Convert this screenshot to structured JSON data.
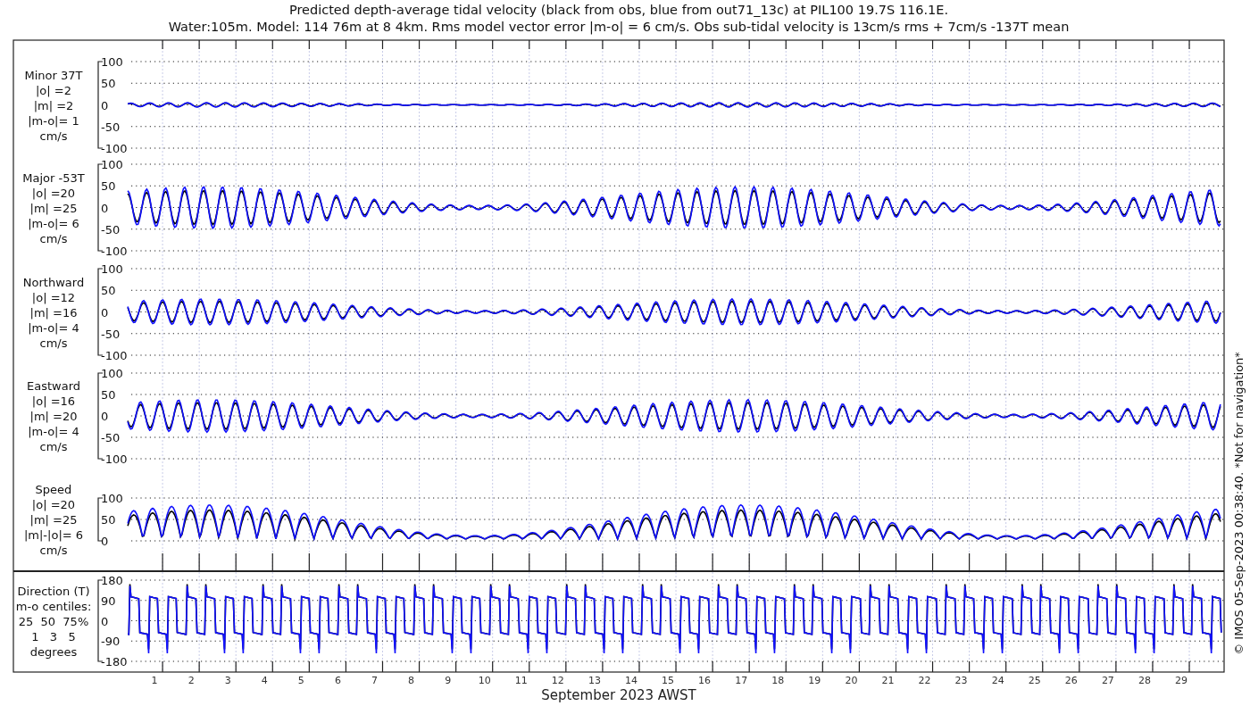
{
  "title_lines": [
    "Predicted depth-average tidal velocity (black from obs, blue from out71_13c) at PIL100 19.7S 116.1E.",
    "Water:105m. Model: 114 76m at 8 4km. Rms model vector error |m-o| = 6 cm/s. Obs sub-tidal velocity is 13cm/s rms + 7cm/s -137T mean"
  ],
  "panels": [
    {
      "kind": "signed",
      "label_lines": [
        "Minor 37T",
        "|o| =2",
        "|m| =2",
        "|m-o|= 1",
        "cm/s"
      ],
      "yticks": [
        "100",
        "50",
        "0",
        "-50",
        "-100"
      ]
    },
    {
      "kind": "signed",
      "label_lines": [
        "Major -53T",
        "|o| =20",
        "|m| =25",
        "|m-o|= 6",
        "cm/s"
      ],
      "yticks": [
        "100",
        "50",
        "0",
        "-50",
        "-100"
      ]
    },
    {
      "kind": "signed",
      "label_lines": [
        "Northward",
        "|o| =12",
        "|m| =16",
        "|m-o|= 4",
        "cm/s"
      ],
      "yticks": [
        "100",
        "50",
        "0",
        "-50",
        "-100"
      ]
    },
    {
      "kind": "signed",
      "label_lines": [
        "Eastward",
        "|o| =16",
        "|m| =20",
        "|m-o|= 4",
        "cm/s"
      ],
      "yticks": [
        "100",
        "50",
        "0",
        "-50",
        "-100"
      ]
    },
    {
      "kind": "speed",
      "label_lines": [
        "Speed",
        "|o| =20",
        "|m| =25",
        "|m|-|o|= 6",
        "cm/s"
      ],
      "yticks": [
        "100",
        "50",
        "0"
      ]
    }
  ],
  "direction_panel": {
    "label_lines": [
      "Direction (T)",
      "m-o centiles:",
      "25  50  75%",
      "1   3   5",
      "degrees"
    ],
    "yticks": [
      "180",
      "90",
      "0",
      "-90",
      "-180"
    ]
  },
  "x_tick_labels": [
    "1",
    "2",
    "3",
    "4",
    "5",
    "6",
    "7",
    "8",
    "9",
    "10",
    "11",
    "12",
    "13",
    "14",
    "15",
    "16",
    "17",
    "18",
    "19",
    "20",
    "21",
    "22",
    "23",
    "24",
    "25",
    "26",
    "27",
    "28",
    "29"
  ],
  "xlabel": "September 2023 AWST",
  "credit": "© IMOS 05-Sep-2023 00:38:40. *Not for navigation*"
}
